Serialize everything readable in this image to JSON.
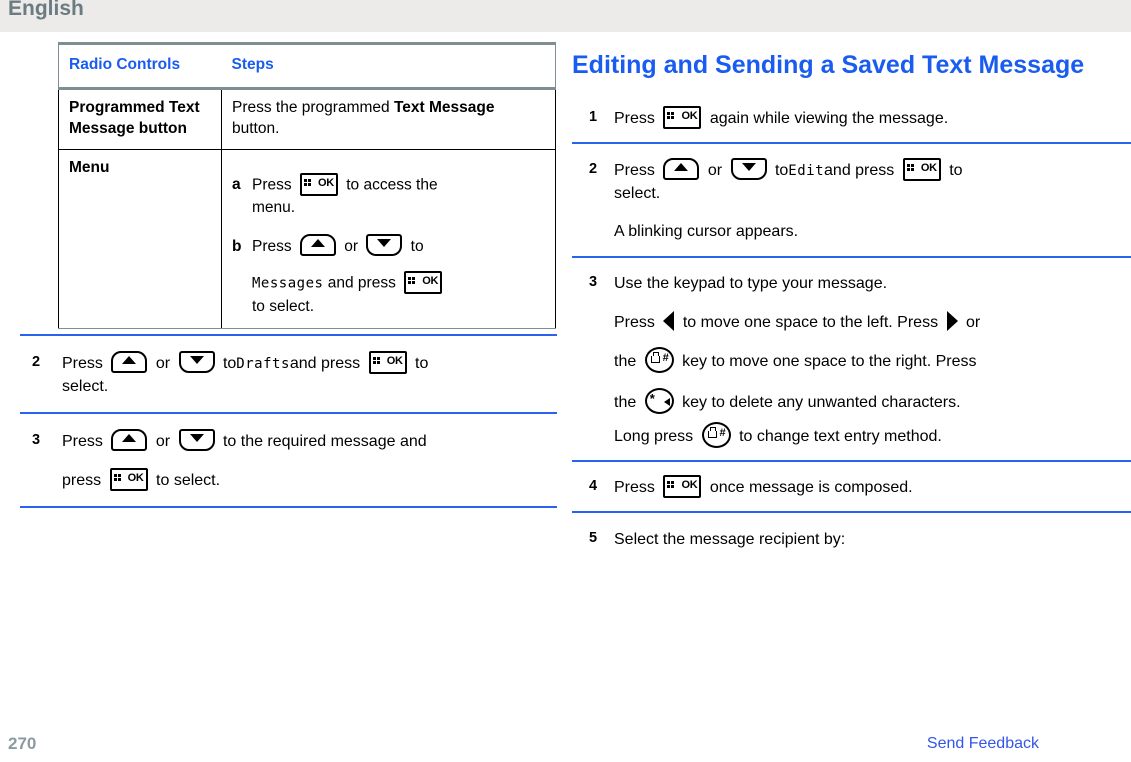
{
  "header": {
    "language": "English"
  },
  "left_column": {
    "table": {
      "headers": [
        "Radio Controls",
        "Steps"
      ],
      "rows": [
        {
          "control": "Programmed Text Message button",
          "steps_text_1": "Press the programmed ",
          "steps_bold": "Text Message",
          "steps_text_2": " button."
        },
        {
          "control": "Menu",
          "substeps": [
            {
              "marker": "a",
              "line1_pre": "Press",
              "line1_post": "to access the",
              "line2": "menu."
            },
            {
              "marker": "b",
              "line1_pre": "Press",
              "line1_mid": "or",
              "line1_post": "to",
              "line2_lcd": "Messages",
              "line2_mid": "and press",
              "line3": "to select."
            }
          ]
        }
      ]
    },
    "steps": [
      {
        "num": "2",
        "pre": "Press",
        "mid": "or",
        "to": "to",
        "lcd": "Drafts",
        "post": "and press",
        "tail": "to",
        "line2": "select."
      },
      {
        "num": "3",
        "pre": "Press",
        "mid": "or",
        "post": "to the required message and",
        "line2_pre": "press",
        "line2_post": "to select."
      }
    ]
  },
  "right_column": {
    "heading": "Editing and Sending a Saved Text Message",
    "steps": [
      {
        "num": "1",
        "pre": "Press",
        "post": "again while viewing the message."
      },
      {
        "num": "2",
        "pre": "Press",
        "mid": "or",
        "to": "to",
        "lcd": "Edit",
        "post": "and press",
        "tail": "to",
        "line2": "select.",
        "line3": "A blinking cursor appears."
      },
      {
        "num": "3",
        "line1": "Use the keypad to type your message.",
        "line2_a": "Press",
        "line2_b": "to move one space to the left. Press",
        "line2_c": "or",
        "line3_a": "the",
        "line3_b": "key to move one space to the right. Press",
        "line4_a": "the",
        "line4_b": "key to delete any unwanted characters.",
        "line5_a": "Long press",
        "line5_b": "to change text entry method."
      },
      {
        "num": "4",
        "pre": "Press",
        "post": "once message is composed."
      },
      {
        "num": "5",
        "line1": "Select the message recipient by:"
      }
    ]
  },
  "footer": {
    "page_number": "270",
    "feedback_link": "Send Feedback"
  },
  "icons": {
    "ok_label": "OK",
    "hash_label": "#",
    "star_label": "*"
  },
  "colors": {
    "heading_blue": "#1a5cf0",
    "rule_blue": "#2a62ec",
    "header_band": "#ecebe9",
    "header_text": "#6b7b82",
    "page_number": "#8c9aa0",
    "link_blue": "#3355e8"
  }
}
